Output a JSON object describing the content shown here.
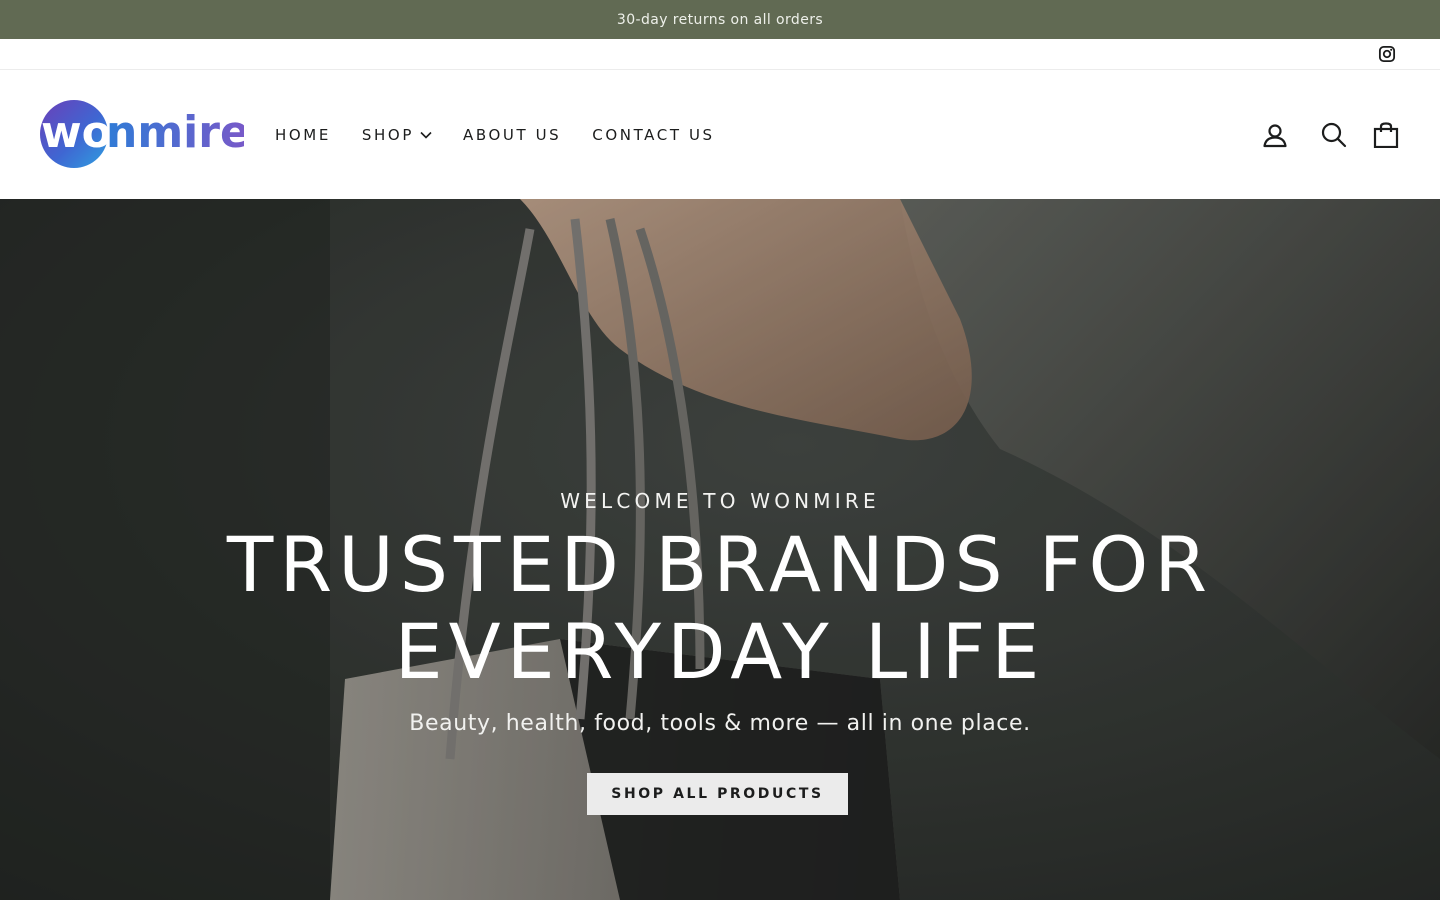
{
  "announcement": {
    "text": "30-day returns on all orders",
    "background": "#616a53"
  },
  "utility": {
    "social_icon": "instagram-icon"
  },
  "header": {
    "logo": {
      "text": "wonmire",
      "highlighted_part": "wo",
      "rest_part": "nmire",
      "colors": [
        "#3b6ed8",
        "#6a4fc4"
      ]
    },
    "nav": [
      {
        "label": "HOME"
      },
      {
        "label": "SHOP",
        "has_dropdown": true
      },
      {
        "label": "ABOUT US"
      },
      {
        "label": "CONTACT US"
      }
    ],
    "icons": [
      "account-icon",
      "search-icon",
      "cart-icon"
    ]
  },
  "hero": {
    "eyebrow": "WELCOME TO WONMIRE",
    "title_line1": "TRUSTED BRANDS FOR",
    "title_line2": "EVERYDAY LIFE",
    "subtitle": "Beauty, health, food, tools & more — all in one place.",
    "cta_label": "SHOP ALL PRODUCTS"
  }
}
